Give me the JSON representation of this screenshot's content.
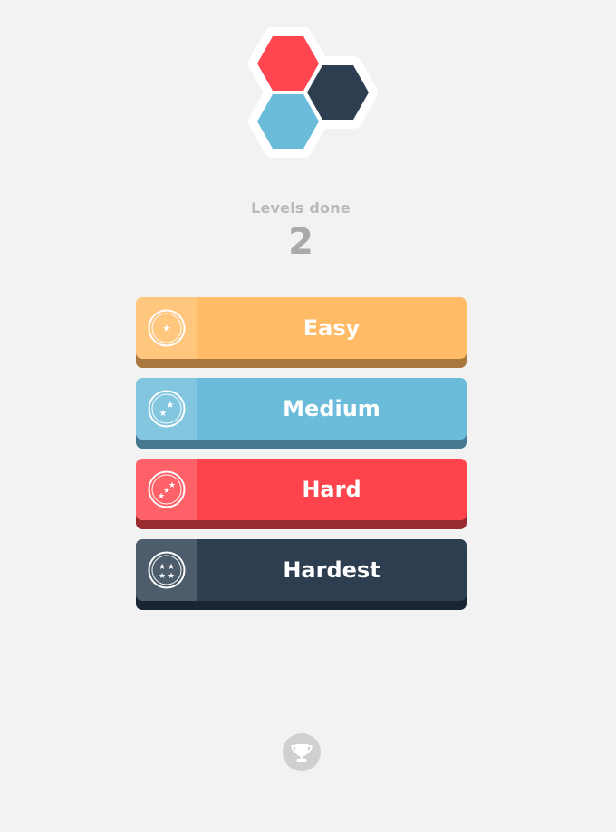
{
  "logo": {
    "hexagons": [
      {
        "color": "#ff4550"
      },
      {
        "color": "#2c3e50"
      },
      {
        "color": "#6bbcdb"
      }
    ]
  },
  "progress": {
    "label": "Levels done",
    "count": "2"
  },
  "difficulties": [
    {
      "label": "Easy",
      "color": "#ffbb66",
      "shadow": "#a8773d",
      "stars": 1,
      "icon": "one-star-icon"
    },
    {
      "label": "Medium",
      "color": "#6bbcdb",
      "shadow": "#457891",
      "stars": 2,
      "icon": "two-stars-icon"
    },
    {
      "label": "Hard",
      "color": "#ff434c",
      "shadow": "#992a30",
      "stars": 3,
      "icon": "three-stars-icon"
    },
    {
      "label": "Hardest",
      "color": "#2c3e50",
      "shadow": "#1a2533",
      "stars": 4,
      "icon": "four-stars-icon"
    }
  ],
  "footer": {
    "trophy_icon": "trophy-icon"
  }
}
